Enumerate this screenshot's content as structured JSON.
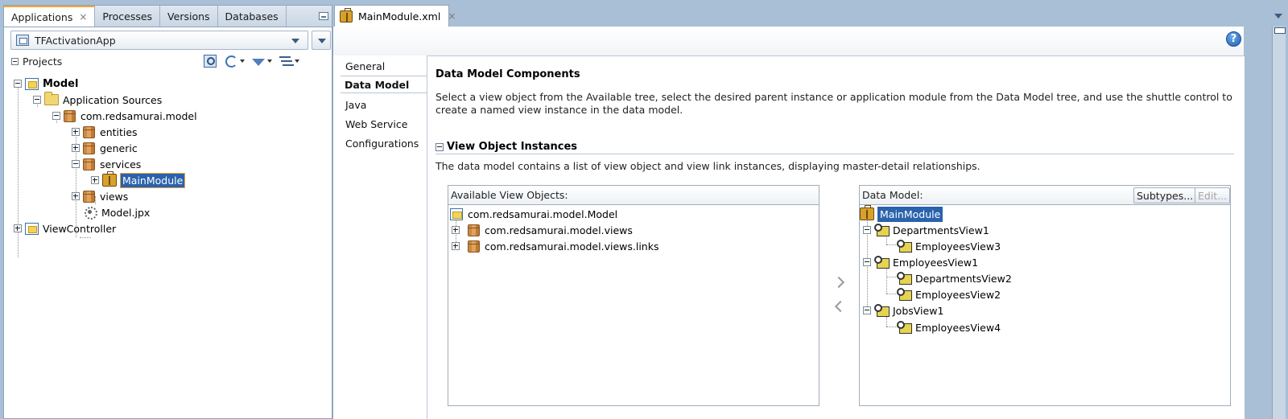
{
  "left_panel": {
    "tabs": [
      {
        "label": "Applications",
        "active": true
      },
      {
        "label": "Processes"
      },
      {
        "label": "Versions"
      },
      {
        "label": "Databases"
      }
    ],
    "tab_close_glyph": "×",
    "application": "TFActivationApp",
    "projects_label": "Projects",
    "tree": {
      "model": "Model",
      "application_sources": "Application Sources",
      "package": "com.redsamurai.model",
      "entities": "entities",
      "generic": "generic",
      "services": "services",
      "main_module": "MainModule",
      "views": "views",
      "model_jpx": "Model.jpx",
      "view_controller": "ViewController"
    }
  },
  "editor": {
    "tab_label": "MainModule.xml",
    "tab_close_glyph": "×",
    "help_glyph": "?",
    "nav": [
      "General",
      "Data Model",
      "Java",
      "Web Service",
      "Configurations"
    ],
    "active_nav": "Data Model",
    "title": "Data Model Components",
    "description": "Select a view object from the Available tree, select the desired parent instance or application module from the Data Model tree, and use the shuttle control to create a named view instance in the data model.",
    "section_title": "View Object Instances",
    "section_description": "The data model contains a list of view object and view link instances, displaying master-detail relationships.",
    "available": {
      "header": "Available View Objects:",
      "items": [
        "com.redsamurai.model.Model",
        "com.redsamurai.model.views",
        "com.redsamurai.model.views.links"
      ]
    },
    "data_model": {
      "header": "Data Model:",
      "subtypes_button": "Subtypes...",
      "edit_button": "Edit...",
      "root": "MainModule",
      "items": [
        "DepartmentsView1",
        "EmployeesView3",
        "EmployeesView1",
        "DepartmentsView2",
        "EmployeesView2",
        "JobsView1",
        "EmployeesView4"
      ]
    }
  },
  "colors": {
    "selection": "#2a62ad",
    "active_tab_accent": "#f2a33a",
    "frame": "#a9bfd6"
  }
}
